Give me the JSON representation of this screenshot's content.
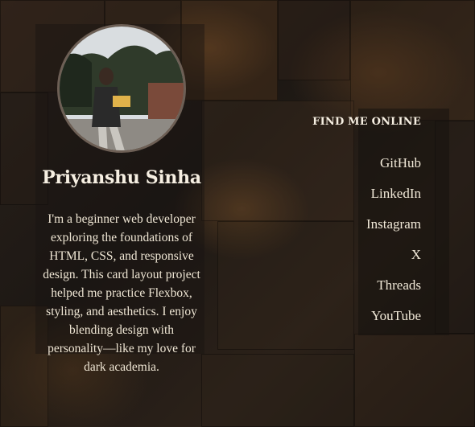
{
  "profile": {
    "name": "Priyanshu Sinha",
    "bio": "I'm a beginner web developer exploring the foundations of HTML, CSS, and responsive design. This card layout project helped me practice Flexbox, styling, and aesthetics. I enjoy blending design with personality—like my love for dark academia."
  },
  "links": {
    "heading": "FIND ME ONLINE",
    "items": [
      {
        "label": "GitHub",
        "name": "link-github"
      },
      {
        "label": "LinkedIn",
        "name": "link-linkedin"
      },
      {
        "label": "Instagram",
        "name": "link-instagram"
      },
      {
        "label": "X",
        "name": "link-x"
      },
      {
        "label": "Threads",
        "name": "link-threads"
      },
      {
        "label": "YouTube",
        "name": "link-youtube"
      }
    ]
  },
  "colors": {
    "background": "#1d1814",
    "text": "#f1e9d8",
    "avatar_border": "#6d5f55"
  }
}
